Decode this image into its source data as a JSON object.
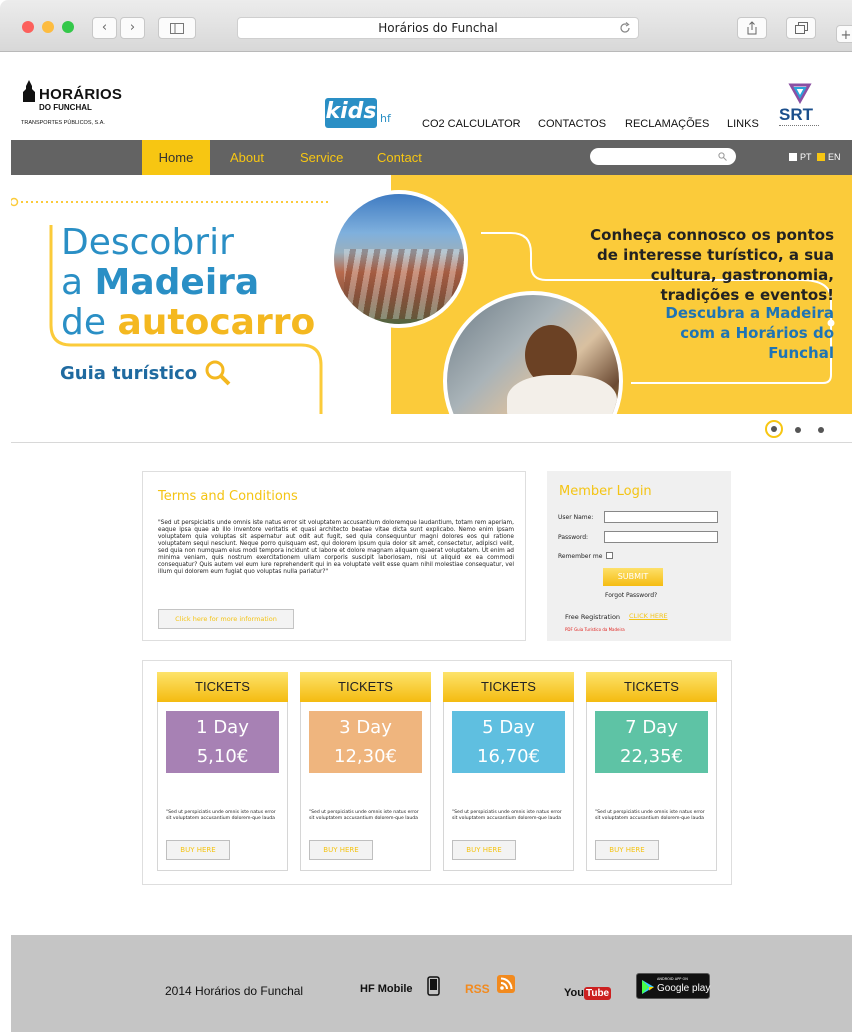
{
  "browser": {
    "title": "Horários do Funchal",
    "back_glyph": "‹",
    "forward_glyph": "›"
  },
  "header": {
    "logo": {
      "name": "HORÁRIOS",
      "sub": "DO FUNCHAL",
      "tagline": "TRANSPORTES PÚBLICOS, S.A."
    },
    "kids": {
      "text": "kids",
      "suffix": "hf"
    },
    "links": [
      "CO2 CALCULATOR",
      "CONTACTOS",
      "RECLAMAÇÕES",
      "LINKS"
    ],
    "srt": {
      "text": "SRT"
    }
  },
  "menu": {
    "items": [
      "Home",
      "About",
      "Service",
      "Contact"
    ],
    "active": "Home",
    "lang": [
      "PT",
      "EN"
    ]
  },
  "hero": {
    "title_line1": "Descobrir",
    "title_line2_a": "a ",
    "title_line2_b": "Madeira",
    "title_line3_a": "de ",
    "title_line3_b": "autocarro",
    "guide": "Guia turístico",
    "text1": "Conheça connosco os pontos de interesse turístico, a sua cultura, gastronomia, tradições e eventos!",
    "text2": "Descubra a Madeira com a Horários do Funchal",
    "slide_active": 1,
    "slide_count": 3
  },
  "terms": {
    "title": "Terms and Conditions",
    "body": "\"Sed ut perspiciatis unde omnis iste natus error sit voluptatem accusantium doloremque laudantium, totam rem aperiam, eaque ipsa quae ab illo inventore veritatis et quasi architecto beatae vitae dicta sunt explicabo. Nemo enim ipsam voluptatem quia voluptas sit aspernatur aut odit aut fugit, sed quia consequuntur magni dolores eos qui ratione voluptatem sequi nesciunt. Neque porro quisquam est, qui dolorem ipsum quia dolor sit amet, consectetur, adipisci velit, sed quia non numquam eius modi tempora incidunt ut labore et dolore magnam aliquam quaerat voluptatem. Ut enim ad minima veniam, quis nostrum exercitationem ullam corporis suscipit laboriosam, nisi ut aliquid ex ea commodi consequatur? Quis autem vel eum iure reprehenderit qui in ea voluptate velit esse quam nihil molestiae consequatur, vel illum qui dolorem eum fugiat quo voluptas nulla pariatur?\"",
    "button": "Click here for more information"
  },
  "login": {
    "title": "Member Login",
    "username_label": "User Name:",
    "password_label": "Password:",
    "remember_label": "Remember me",
    "submit": "SUBMIT",
    "forgot": "Forgot Password?",
    "register_label": "Free Registration",
    "register_link": "CLICK HERE",
    "pdf_link": "PDF Guia Turístico da Madeira"
  },
  "tickets": [
    {
      "header": "TICKETS",
      "days": "1 Day",
      "price": "5,10€",
      "color": "#a781b4",
      "desc": "\"Sed ut perspiciatis unde omnis iste natus error sit voluptatem accusantium dolorem-que lauda",
      "button": "BUY HERE"
    },
    {
      "header": "TICKETS",
      "days": "3 Day",
      "price": "12,30€",
      "color": "#efb57e",
      "desc": "\"Sed ut perspiciatis unde omnis iste natus error sit voluptatem accusantium dolorem-que lauda",
      "button": "BUY HERE"
    },
    {
      "header": "TICKETS",
      "days": "5 Day",
      "price": "16,70€",
      "color": "#5fbfe0",
      "desc": "\"Sed ut perspiciatis unde omnis iste natus error sit voluptatem accusantium dolorem-que lauda",
      "button": "BUY HERE"
    },
    {
      "header": "TICKETS",
      "days": "7 Day",
      "price": "22,35€",
      "color": "#5ec3a5",
      "desc": "\"Sed ut perspiciatis unde omnis iste natus error sit voluptatem accusantium dolorem-que lauda",
      "button": "BUY HERE"
    }
  ],
  "footer": {
    "copyright": "2014 Horários do Funchal",
    "hf_mobile": "HF Mobile",
    "rss": "RSS",
    "youtube_a": "You",
    "youtube_b": "Tube",
    "gplay_small": "ANDROID APP ON",
    "gplay": "Google play"
  },
  "colors": {
    "accent_yellow": "#f7c612",
    "brand_blue": "#2a8fc5",
    "nav_gray": "#636363",
    "footer_gray": "#c5c5c5"
  }
}
